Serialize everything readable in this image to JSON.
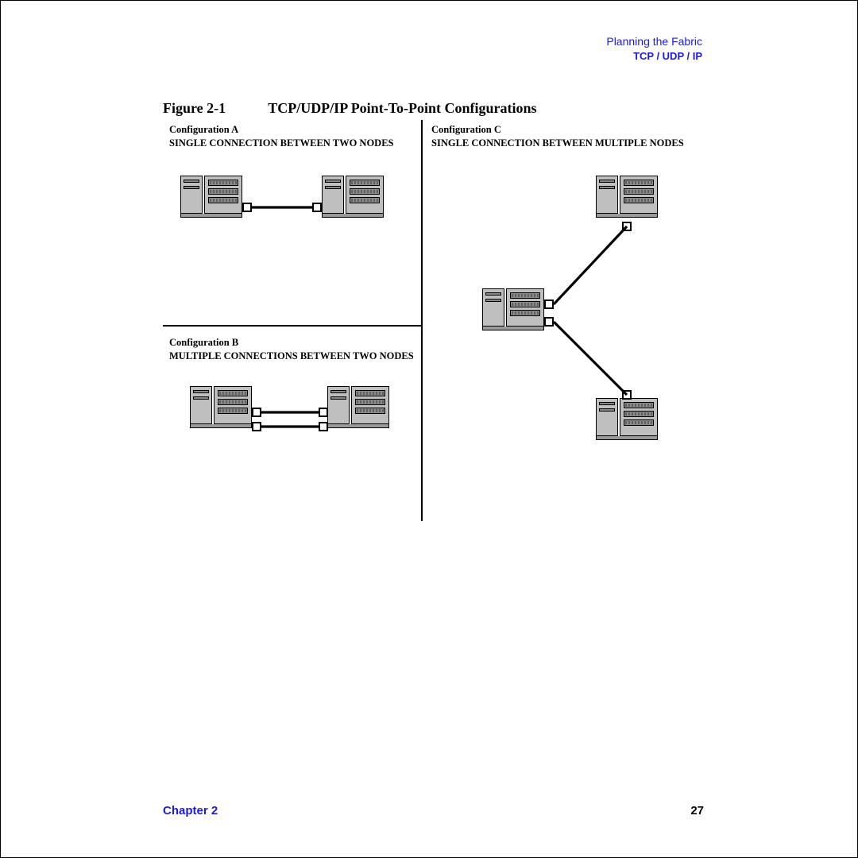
{
  "header": {
    "line1": "Planning the Fabric",
    "line2": "TCP / UDP / IP"
  },
  "figure": {
    "number": "Figure 2-1",
    "title": "TCP/UDP/IP Point-To-Point Configurations"
  },
  "configs": {
    "a": {
      "name": "Configuration A",
      "desc": "SINGLE CONNECTION BETWEEN TWO NODES"
    },
    "b": {
      "name": "Configuration B",
      "desc": "MULTIPLE CONNECTIONS  BETWEEN TWO NODES"
    },
    "c": {
      "name": "Configuration C",
      "desc": "SINGLE CONNECTION  BETWEEN MULTIPLE NODES"
    }
  },
  "footer": {
    "chapter": "Chapter 2",
    "page": "27"
  }
}
